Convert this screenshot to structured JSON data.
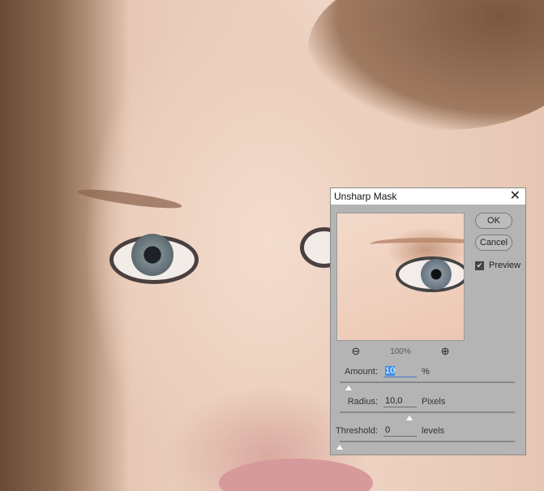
{
  "dialog": {
    "title": "Unsharp Mask",
    "close_icon": "close-icon",
    "ok_label": "OK",
    "cancel_label": "Cancel",
    "preview_label": "Preview",
    "preview_checked": true,
    "zoom_level": "100%",
    "amount": {
      "label": "Amount:",
      "value": "10",
      "unit": "%",
      "slider_fraction": 0.05
    },
    "radius": {
      "label": "Radius:",
      "value": "10,0",
      "unit": "Pixels",
      "slider_fraction": 0.4
    },
    "threshold": {
      "label": "Threshold:",
      "value": "0",
      "unit": "levels",
      "slider_fraction": 0.0
    }
  }
}
